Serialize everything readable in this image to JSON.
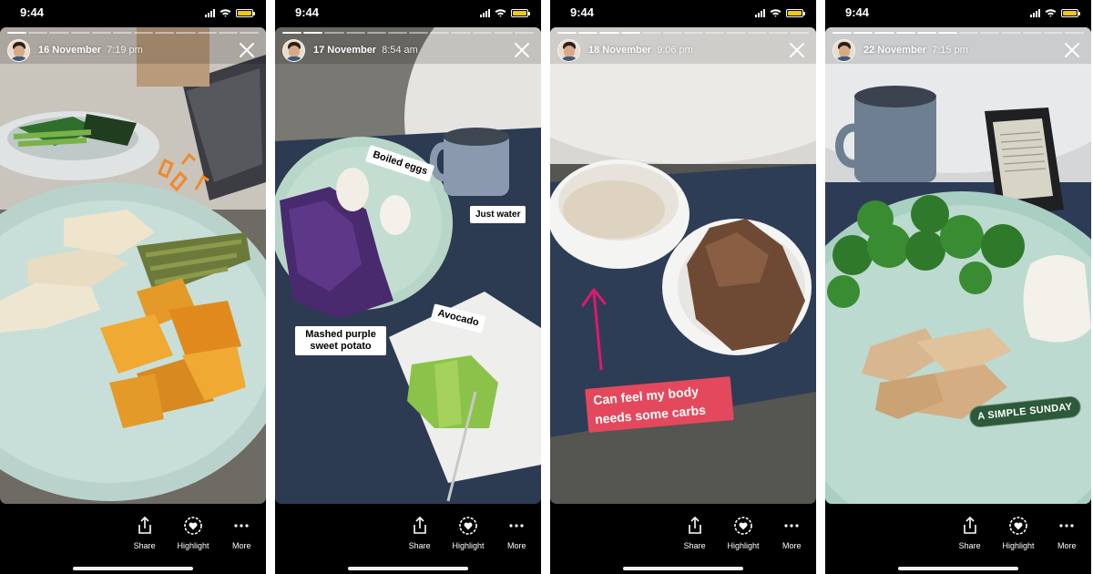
{
  "status_bar": {
    "time": "9:44"
  },
  "actions": {
    "share": "Share",
    "highlight": "Highlight",
    "more": "More"
  },
  "icons": {
    "share": "share-icon",
    "highlight": "heart-circle-icon",
    "more": "more-dots-icon",
    "close": "close-icon"
  },
  "colors": {
    "pink_sticker": "#e4485c",
    "green_sticker": "#2c5a3b",
    "battery": "#f5c518"
  },
  "stories": [
    {
      "date": "16 November",
      "time": "7:19 pm",
      "stickers": []
    },
    {
      "date": "17 November",
      "time": "8:54 am",
      "stickers": [
        "Boiled eggs",
        "Just water",
        "Mashed purple sweet potato",
        "Avocado"
      ]
    },
    {
      "date": "18 November",
      "time": "9:06 pm",
      "stickers": [
        "Can feel my body needs some carbs"
      ]
    },
    {
      "date": "22 November",
      "time": "7:15 pm",
      "stickers": [
        "A SIMPLE SUNDAY"
      ]
    }
  ]
}
